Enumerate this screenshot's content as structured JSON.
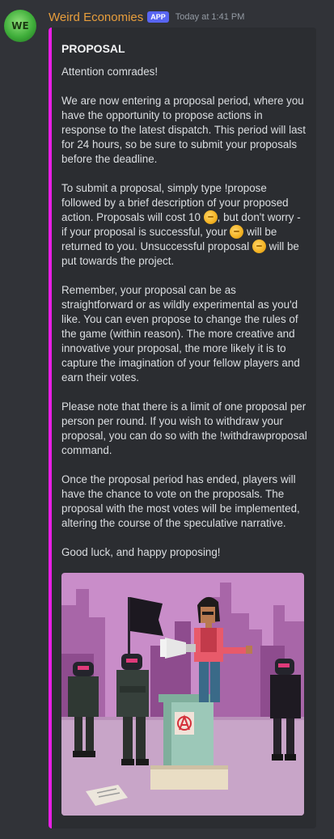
{
  "message": {
    "avatar_initials": "WE",
    "username": "Weird Economies",
    "badge": "APP",
    "timestamp": "Today at 1:41 PM"
  },
  "embed": {
    "accent_color": "#e91ee6",
    "title": "PROPOSAL",
    "paragraphs": {
      "p1": "Attention comrades!",
      "p2": "We are now entering a proposal period, where you have the opportunity to propose actions in response to the latest dispatch. This period will last for 24 hours, so be sure to submit your proposals before the deadline.",
      "p3a": "To submit a proposal, simply type !propose followed by a brief description of your proposed action. Proposals will cost 10 ",
      "p3b": ", but don't worry - if your proposal is successful, your ",
      "p3c": " will be returned to you. Unsuccessful proposal ",
      "p3d": " will be put towards the project.",
      "p4": "Remember, your proposal can be as straightforward or as wildly experimental as you'd like. You can even propose to change the rules of the game (within reason). The more creative and innovative your proposal, the more likely it is to capture the imagination of your fellow players and earn their votes.",
      "p5": "Please note that there is a limit of one proposal per person per round. If you wish to withdraw your proposal, you can do so with the !withdrawproposal command.",
      "p6": "Once the proposal period has ended, players will have the chance to vote on the proposals. The proposal with the most votes will be implemented, altering the course of the speculative narrative.",
      "p7": "Good luck, and happy proposing!"
    },
    "coin_icon": "coin-emoji"
  }
}
